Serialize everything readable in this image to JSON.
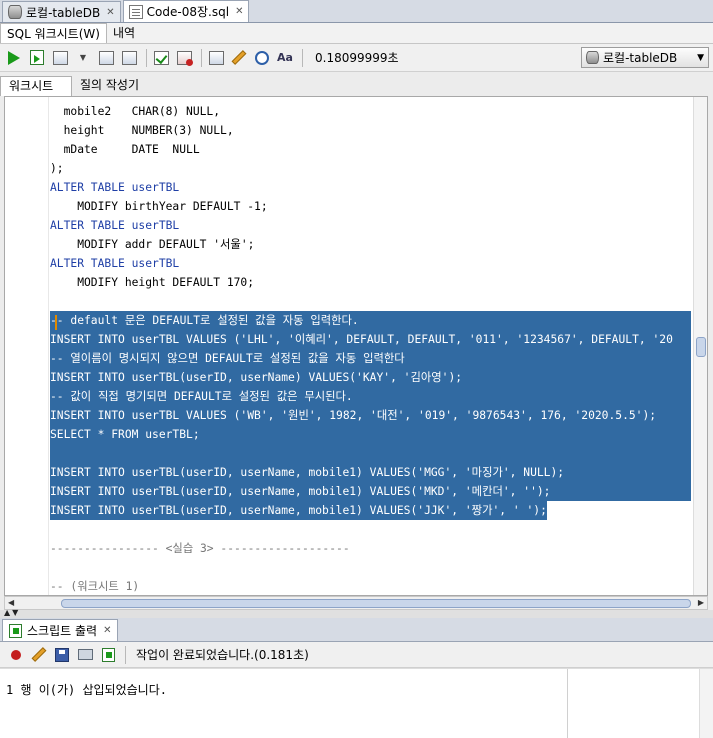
{
  "tabs": [
    {
      "label": "로컬-tableDB",
      "icon": "database-icon"
    },
    {
      "label": "Code-08장.sql",
      "icon": "sql-file-icon"
    }
  ],
  "subtabs": [
    "SQL 워크시트(W)",
    "내역"
  ],
  "toolbar": {
    "elapsed": "0.18099999초",
    "connection": "로컬-tableDB"
  },
  "worksheet_tabs": [
    "워크시트",
    "질의 작성기"
  ],
  "editor": {
    "lines": [
      "  mobile2   CHAR(8) NULL,",
      "  height    NUMBER(3) NULL,",
      "  mDate     DATE  NULL",
      ");",
      "ALTER TABLE userTBL",
      "    MODIFY birthYear DEFAULT -1;",
      "ALTER TABLE userTBL",
      "    MODIFY addr DEFAULT '서울';",
      "ALTER TABLE userTBL",
      "    MODIFY height DEFAULT 170;",
      "",
      "-- default 문은 DEFAULT로 설정된 값을 자동 입력한다.",
      "INSERT INTO userTBL VALUES ('LHL', '이혜리', DEFAULT, DEFAULT, '011', '1234567', DEFAULT, '20",
      "-- 열이름이 명시되지 않으면 DEFAULT로 설정된 값을 자동 입력한다",
      "INSERT INTO userTBL(userID, userName) VALUES('KAY', '김아영');",
      "-- 값이 직접 명기되면 DEFAULT로 설정된 값은 무시된다.",
      "INSERT INTO userTBL VALUES ('WB', '원빈', 1982, '대전', '019', '9876543', 176, '2020.5.5');",
      "SELECT * FROM userTBL;",
      "",
      "INSERT INTO userTBL(userID, userName, mobile1) VALUES('MGG', '마징가', NULL);",
      "INSERT INTO userTBL(userID, userName, mobile1) VALUES('MKD', '메칸더', '');",
      "INSERT INTO userTBL(userID, userName, mobile1) VALUES('JJK', '짱가', ' ');",
      "",
      "---------------- <실습 3> -------------------",
      "",
      "-- (워크시트 1)"
    ]
  },
  "output": {
    "tab_label": "스크립트 출력",
    "status": "작업이 완료되었습니다.(0.181초)",
    "result": "1 행 이(가) 삽입되었습니다."
  }
}
